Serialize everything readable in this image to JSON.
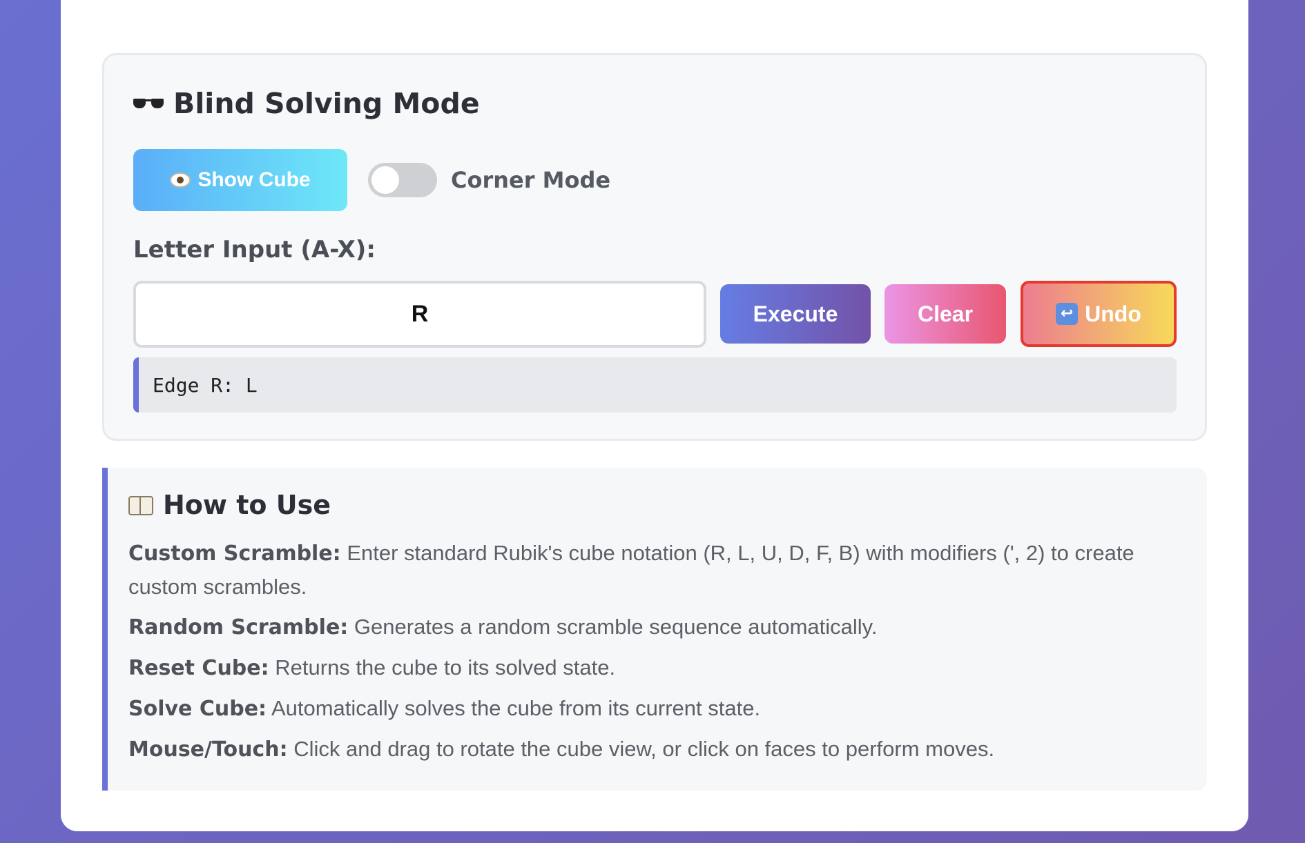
{
  "blind": {
    "title": "Blind Solving Mode",
    "show_cube_label": "Show Cube",
    "corner_mode_label": "Corner Mode",
    "corner_mode_on": false,
    "letter_input_label": "Letter Input (A-X):",
    "letter_input_value": "R",
    "execute_label": "Execute",
    "clear_label": "Clear",
    "undo_label": "Undo",
    "result_text": "Edge R: L"
  },
  "howto": {
    "title": "How to Use",
    "items": [
      {
        "term": "Custom Scramble:",
        "desc": "Enter standard Rubik's cube notation (R, L, U, D, F, B) with modifiers (', 2) to create custom scrambles."
      },
      {
        "term": "Random Scramble:",
        "desc": "Generates a random scramble sequence automatically."
      },
      {
        "term": "Reset Cube:",
        "desc": "Returns the cube to its solved state."
      },
      {
        "term": "Solve Cube:",
        "desc": "Automatically solves the cube from its current state."
      },
      {
        "term": "Mouse/Touch:",
        "desc": "Click and drag to rotate the cube view, or click on faces to perform moves."
      }
    ]
  },
  "icons": {
    "blind": "sunglasses-icon",
    "show_cube": "eye-icon",
    "undo": "undo-arrow-icon",
    "howto": "open-book-icon"
  },
  "colors": {
    "accent": "#6a72d8",
    "undo_border": "#e53a2e"
  }
}
